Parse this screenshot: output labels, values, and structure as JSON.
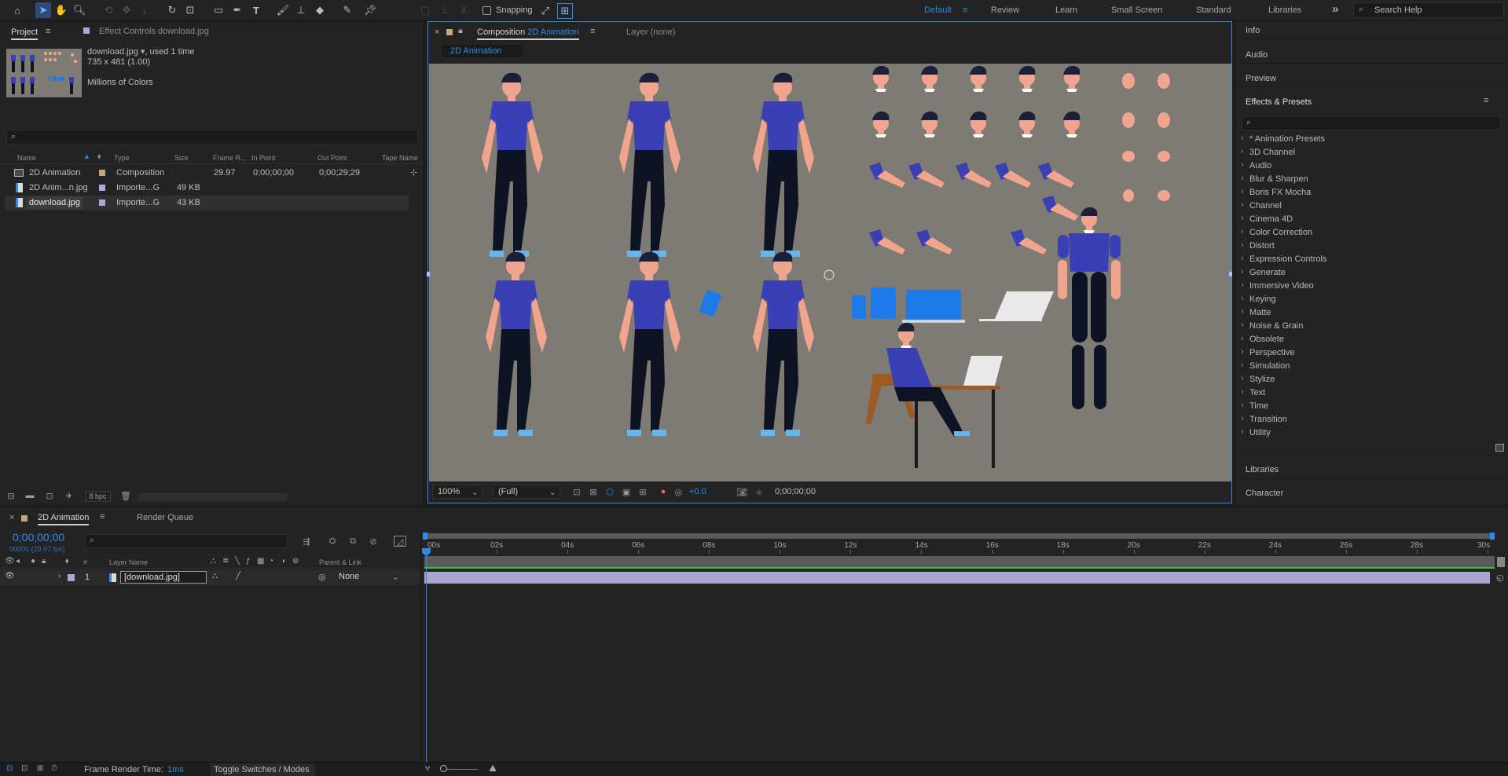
{
  "toolbar": {
    "snapping_label": "Snapping",
    "workspaces": [
      "Default",
      "Review",
      "Learn",
      "Small Screen",
      "Standard",
      "Libraries"
    ],
    "search_placeholder": "Search Help",
    "more_icon": "»"
  },
  "project_panel": {
    "tab_label": "Project",
    "effect_controls_label": "Effect Controls download.jpg",
    "asset_name": "download.jpg",
    "asset_usage": ", used 1 time",
    "asset_dims": "735 x 481 (1.00)",
    "asset_colors": "Millions of Colors",
    "columns": [
      "Name",
      "Type",
      "Size",
      "Frame R...",
      "In Point",
      "Out Point",
      "Tape Name"
    ],
    "items": [
      {
        "name": "2D Animation",
        "type": "Composition",
        "size": "",
        "fps": "29.97",
        "in": "0;00;00;00",
        "out": "0;00;29;29",
        "color": "#c2a77a"
      },
      {
        "name": "2D Anim...n.jpg",
        "type": "Importe...G",
        "size": "49 KB",
        "fps": "",
        "in": "",
        "out": "",
        "color": "#a9a9d6"
      },
      {
        "name": "download.jpg",
        "type": "Importe...G",
        "size": "43 KB",
        "fps": "",
        "in": "",
        "out": "",
        "color": "#a9a9d6"
      }
    ],
    "bpc_label": "8 bpc"
  },
  "composition_panel": {
    "tab_prefix": "Composition",
    "tab_name": "2D Animation",
    "layer_tab": "Layer (none)",
    "breadcrumb": "2D Animation",
    "zoom": "100%",
    "resolution": "(Full)",
    "exposure": "+0.0",
    "timecode": "0;00;00;00"
  },
  "right_panel": {
    "collapsed": [
      "Info",
      "Audio",
      "Preview"
    ],
    "effects_title": "Effects & Presets",
    "effects": [
      "* Animation Presets",
      "3D Channel",
      "Audio",
      "Blur & Sharpen",
      "Boris FX Mocha",
      "Channel",
      "Cinema 4D",
      "Color Correction",
      "Distort",
      "Expression Controls",
      "Generate",
      "Immersive Video",
      "Keying",
      "Matte",
      "Noise & Grain",
      "Obsolete",
      "Perspective",
      "Simulation",
      "Stylize",
      "Text",
      "Time",
      "Transition",
      "Utility"
    ],
    "bottom": [
      "Libraries",
      "Character"
    ]
  },
  "timeline": {
    "tab_label": "2D Animation",
    "render_queue_label": "Render Queue",
    "current_time": "0;00;00;00",
    "fps_label": "00000 (29.97 fps)",
    "layer_name_header": "Layer Name",
    "parent_header": "Parent & Link",
    "hash_header": "#",
    "ruler": [
      "00s",
      "02s",
      "04s",
      "06s",
      "08s",
      "10s",
      "12s",
      "14s",
      "16s",
      "18s",
      "20s",
      "22s",
      "24s",
      "26s",
      "28s",
      "30s"
    ],
    "layers": [
      {
        "index": "1",
        "name": "[download.jpg]",
        "parent": "None"
      }
    ]
  },
  "status_bar": {
    "render_time_label": "Frame Render Time:",
    "render_time_value": "1ms",
    "toggle_label": "Toggle Switches / Modes"
  },
  "colors": {
    "accent": "#2d8ceb",
    "panel": "#232323",
    "background": "#1d1d1d",
    "canvas": "#7d7b74",
    "shirt": "#3a3fb6",
    "skin": "#f2a58e",
    "pants": "#0d1322",
    "layer_bar": "#a9a5cf"
  }
}
